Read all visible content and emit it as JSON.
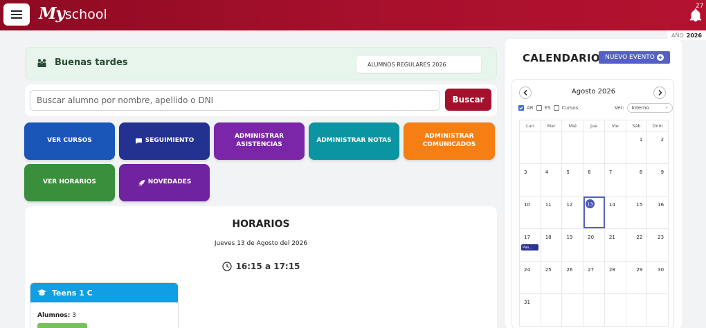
{
  "header": {
    "logo_my": "My",
    "logo_school": "school",
    "notification_count": "27"
  },
  "year_tag": {
    "label": "AÑO",
    "value": "2026"
  },
  "greeting": {
    "text": "Buenas tardes",
    "regular_students": "ALUMNOS REGULARES 2026"
  },
  "search": {
    "placeholder": "Buscar alumno por nombre, apellido o DNI",
    "button": "Buscar"
  },
  "tiles": [
    {
      "label": "VER CURSOS",
      "color": "#1a56b8"
    },
    {
      "label": "SEGUIMIENTO",
      "icon": "chat-icon",
      "color": "#233290"
    },
    {
      "label": "ADMINISTRAR ASISTENCIAS",
      "color": "#7b25a8"
    },
    {
      "label": "ADMINISTRAR NOTAS",
      "color": "#0b95a2"
    },
    {
      "label": "ADMINISTRAR COMUNICADOS",
      "color": "#f57f12"
    },
    {
      "label": "VER HORARIOS",
      "color": "#3a8f3c"
    },
    {
      "label": "NOVEDADES",
      "icon": "rocket-icon",
      "color": "#70239e"
    }
  ],
  "schedule": {
    "title": "HORARIOS",
    "date": "Jueves 13 de Agosto del 2026",
    "time": "16:15 a 17:15",
    "course": {
      "name": "Teens 1 C",
      "students_label": "Alumnos:",
      "students_count": "3"
    }
  },
  "calendar": {
    "title": "CALENDARIO",
    "new_event": "NUEVO EVENTO",
    "month": "Agosto 2026",
    "filters": [
      {
        "label": "AR",
        "checked": true
      },
      {
        "label": "ES",
        "checked": false
      },
      {
        "label": "Cursos",
        "checked": false
      }
    ],
    "view_label": "Ver:",
    "view_value": "Interno",
    "weekdays": [
      "Lun",
      "Mar",
      "Mié",
      "Jue",
      "Vie",
      "Sáb",
      "Dom"
    ],
    "weeks": [
      [
        "",
        "",
        "",
        "",
        "",
        "1",
        "2"
      ],
      [
        "3",
        "4",
        "5",
        "6",
        "7",
        "8",
        "9"
      ],
      [
        "10",
        "11",
        "12",
        "13",
        "14",
        "15",
        "16"
      ],
      [
        "17",
        "18",
        "19",
        "20",
        "21",
        "22",
        "23"
      ],
      [
        "24",
        "25",
        "26",
        "27",
        "28",
        "29",
        "30"
      ],
      [
        "31",
        "",
        "",
        "",
        "",
        "",
        ""
      ]
    ],
    "today": "13",
    "events": [
      {
        "day": "17",
        "label": "Pas..."
      }
    ]
  },
  "colors": {
    "brand": "#a5102c",
    "calendar_accent": "#5560c6",
    "course_header": "#139de2"
  }
}
